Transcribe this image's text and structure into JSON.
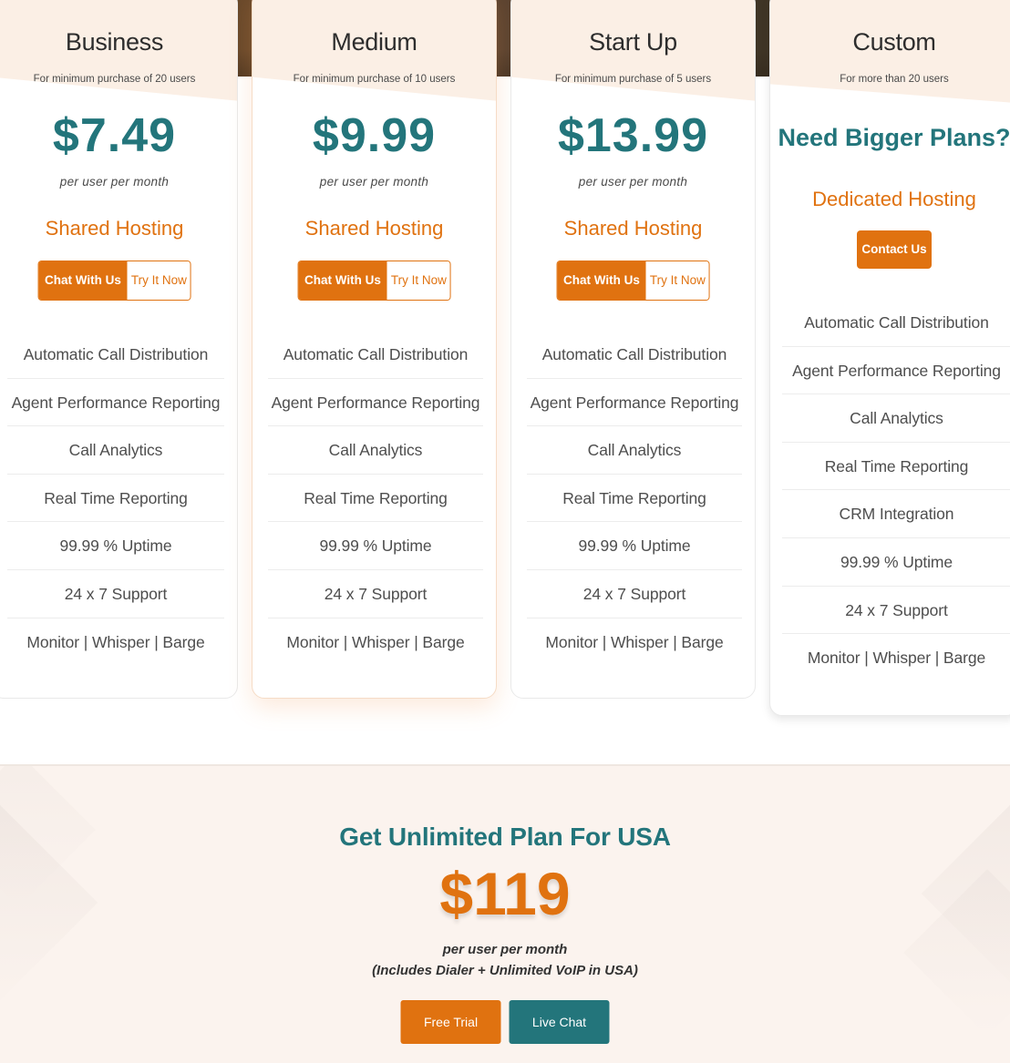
{
  "colors": {
    "accent_teal": "#23757b",
    "accent_orange": "#e07210",
    "header_tint": "#fbefe5",
    "promo_bg": "#fbf3ee"
  },
  "plans": [
    {
      "name": "Business",
      "subtitle": "For minimum purchase of 20 users",
      "price": "$7.49",
      "per": "per user per month",
      "hosting": "Shared Hosting",
      "chat_label": "Chat With Us",
      "try_label": "Try It Now",
      "features": [
        "Automatic Call Distribution",
        "Agent Performance Reporting",
        "Call Analytics",
        "Real Time Reporting",
        "99.99 % Uptime",
        "24 x 7 Support",
        "Monitor | Whisper | Barge"
      ]
    },
    {
      "name": "Medium",
      "subtitle": "For minimum purchase of 10 users",
      "price": "$9.99",
      "per": "per user per month",
      "hosting": "Shared Hosting",
      "chat_label": "Chat With Us",
      "try_label": "Try It Now",
      "features": [
        "Automatic Call Distribution",
        "Agent Performance Reporting",
        "Call Analytics",
        "Real Time Reporting",
        "99.99 % Uptime",
        "24 x 7 Support",
        "Monitor | Whisper | Barge"
      ]
    },
    {
      "name": "Start Up",
      "subtitle": "For minimum purchase of 5 users",
      "price": "$13.99",
      "per": "per user per month",
      "hosting": "Shared Hosting",
      "chat_label": "Chat With Us",
      "try_label": "Try It Now",
      "features": [
        "Automatic Call Distribution",
        "Agent Performance Reporting",
        "Call Analytics",
        "Real Time Reporting",
        "99.99 % Uptime",
        "24 x 7 Support",
        "Monitor | Whisper | Barge"
      ]
    },
    {
      "name": "Custom",
      "subtitle": "For more than 20 users",
      "headline": "Need Bigger Plans?",
      "hosting": "Dedicated Hosting",
      "contact_label": "Contact Us",
      "features": [
        "Automatic Call Distribution",
        "Agent Performance Reporting",
        "Call Analytics",
        "Real Time Reporting",
        "CRM Integration",
        "99.99 % Uptime",
        "24 x 7 Support",
        "Monitor | Whisper | Barge"
      ]
    }
  ],
  "promo": {
    "title": "Get Unlimited Plan For USA",
    "price": "$119",
    "per": "per user per month",
    "includes": "(Includes Dialer + Unlimited VoIP in USA)",
    "free_trial_label": "Free Trial",
    "live_chat_label": "Live Chat"
  }
}
